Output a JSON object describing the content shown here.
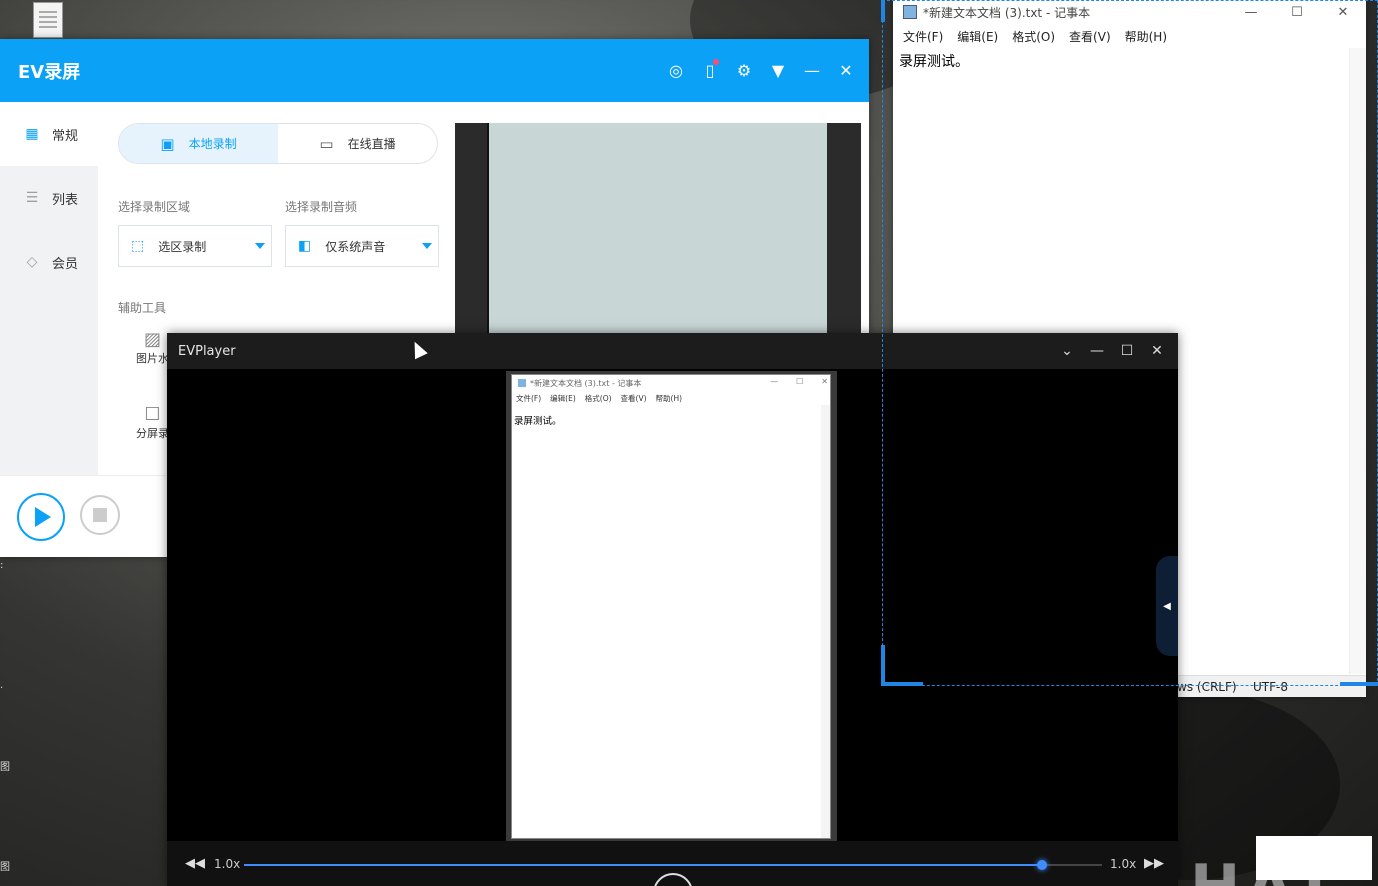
{
  "ev_recorder": {
    "title": "EV录屏",
    "header_icons": [
      "user-icon",
      "mobile-icon",
      "settings-icon",
      "dropdown-icon",
      "minimize-icon",
      "close-icon"
    ],
    "sidebar": [
      {
        "label": "常规",
        "icon": "grid-icon",
        "active": true
      },
      {
        "label": "列表",
        "icon": "list-icon",
        "active": false
      },
      {
        "label": "会员",
        "icon": "diamond-icon",
        "active": false
      }
    ],
    "tabs": [
      {
        "label": "本地录制",
        "active": true
      },
      {
        "label": "在线直播",
        "active": false
      }
    ],
    "region_label": "选择录制区域",
    "region_value": "选区录制",
    "audio_label": "选择录制音频",
    "audio_value": "仅系统声音",
    "tools_label": "辅助工具",
    "tools": [
      {
        "label": "图片水",
        "icon": "image-icon"
      },
      {
        "label": "分屏录",
        "icon": "split-screen-icon"
      }
    ],
    "accent": "#0ba1f7"
  },
  "notepad": {
    "title": "*新建文本文档 (3).txt - 记事本",
    "menu": [
      "文件(F)",
      "编辑(E)",
      "格式(O)",
      "查看(V)",
      "帮助(H)"
    ],
    "content": "录屏测试。",
    "status_eol": "ws (CRLF)",
    "status_encoding": "UTF-8"
  },
  "player": {
    "title": "EVPlayer",
    "speed_left": "1.0x",
    "speed_right": "1.0x",
    "progress": 0.93,
    "accent": "#3f8cff",
    "mini_notepad": {
      "title": "*新建文本文档 (3).txt - 记事本",
      "menu": [
        "文件(F)",
        "编辑(E)",
        "格式(O)",
        "查看(V)",
        "帮助(H)"
      ],
      "content": "录屏测试。"
    }
  }
}
